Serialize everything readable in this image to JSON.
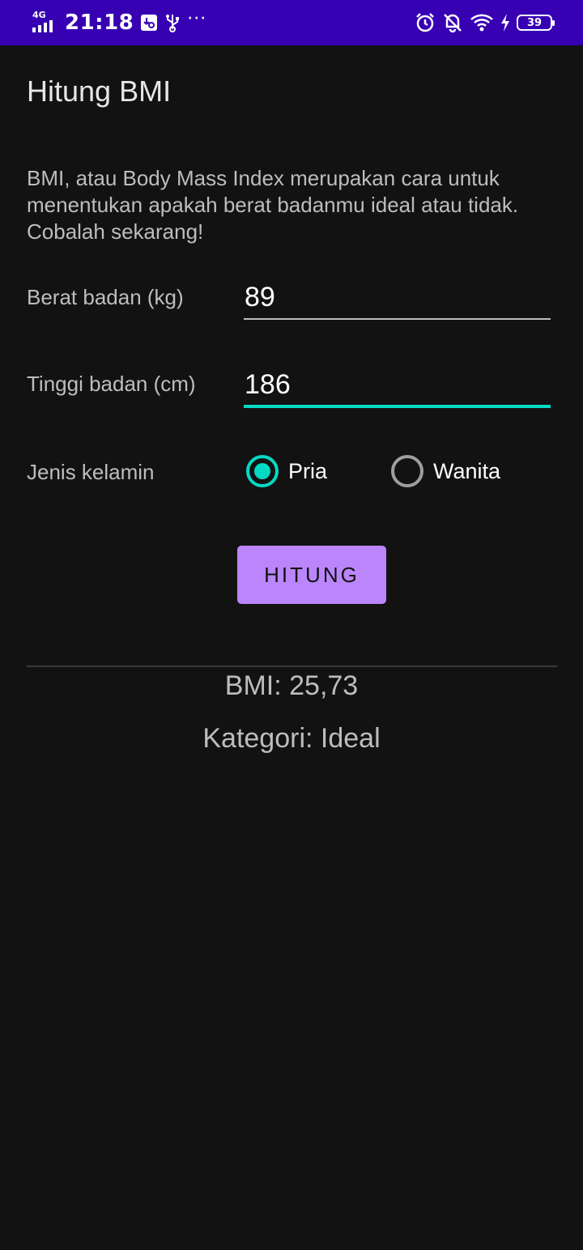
{
  "status_bar": {
    "network_type": "4G",
    "time": "21:18",
    "battery_level": "39",
    "more_icons": "···",
    "icons": [
      "signal-icon",
      "usb-debug-icon",
      "usb-icon",
      "alarm-icon",
      "bell-off-icon",
      "wifi-icon",
      "charging-icon",
      "battery-icon"
    ]
  },
  "app": {
    "title": "Hitung BMI",
    "description": "BMI, atau Body Mass Index merupakan cara untuk menentukan apakah berat badanmu ideal atau tidak. Cobalah sekarang!"
  },
  "form": {
    "weight_label": "Berat badan (kg)",
    "weight_value": "89",
    "height_label": "Tinggi badan (cm)",
    "height_value": "186",
    "gender_label": "Jenis kelamin",
    "gender_options": [
      {
        "label": "Pria",
        "selected": true
      },
      {
        "label": "Wanita",
        "selected": false
      }
    ],
    "submit_label": "HITUNG"
  },
  "result": {
    "bmi_text": "BMI: 25,73",
    "category_text": "Kategori: Ideal"
  },
  "colors": {
    "status_bar": "#3700B3",
    "background": "#121212",
    "accent": "#03DAC5",
    "button": "#BB86FC"
  }
}
